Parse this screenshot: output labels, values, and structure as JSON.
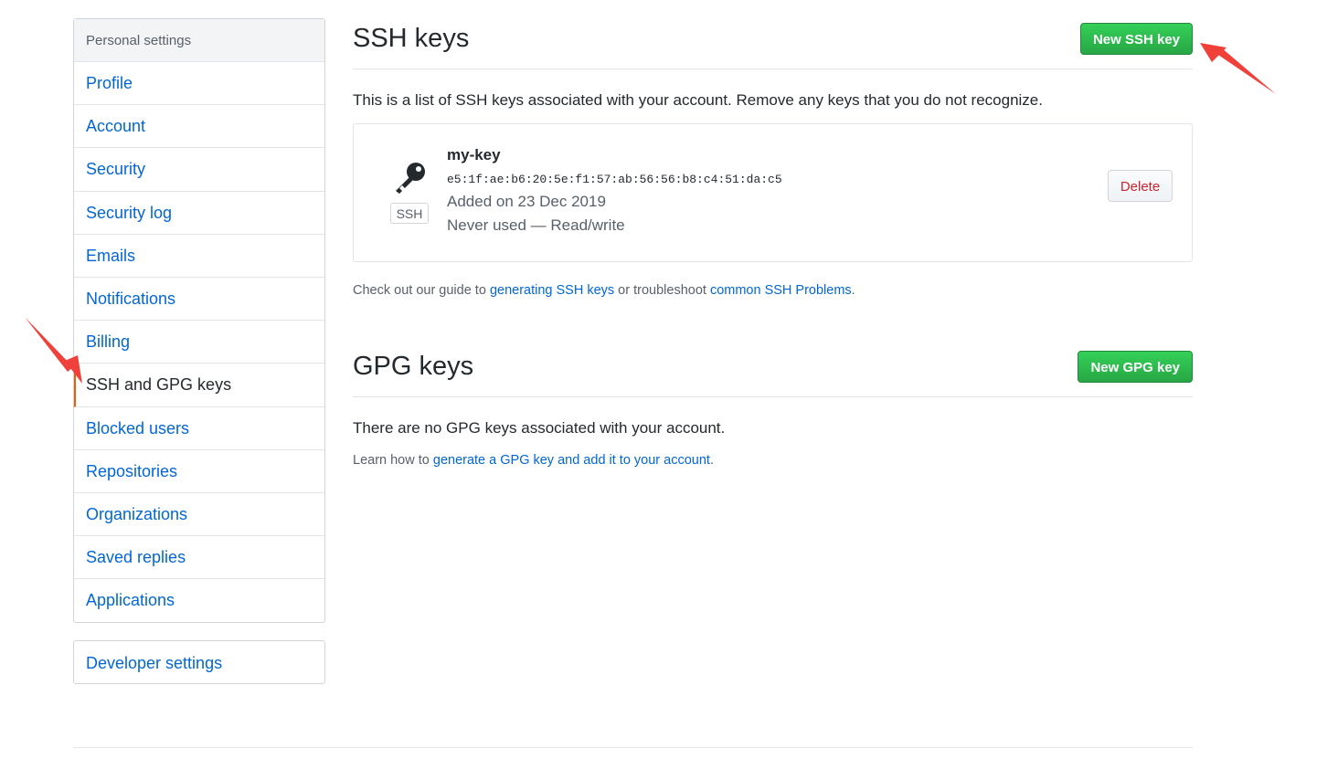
{
  "sidebar": {
    "header": "Personal settings",
    "items": [
      {
        "label": "Profile"
      },
      {
        "label": "Account"
      },
      {
        "label": "Security"
      },
      {
        "label": "Security log"
      },
      {
        "label": "Emails"
      },
      {
        "label": "Notifications"
      },
      {
        "label": "Billing"
      },
      {
        "label": "SSH and GPG keys",
        "selected": true
      },
      {
        "label": "Blocked users"
      },
      {
        "label": "Repositories"
      },
      {
        "label": "Organizations"
      },
      {
        "label": "Saved replies"
      },
      {
        "label": "Applications"
      }
    ],
    "developer_settings": "Developer settings"
  },
  "ssh": {
    "title": "SSH keys",
    "new_button": "New SSH key",
    "description": "This is a list of SSH keys associated with your account. Remove any keys that you do not recognize.",
    "key": {
      "icon": "key-icon",
      "type_tag": "SSH",
      "name": "my-key",
      "fingerprint": "e5:1f:ae:b6:20:5e:f1:57:ab:56:56:b8:c4:51:da:c5",
      "added": "Added on 23 Dec 2019",
      "usage": "Never used — Read/write",
      "delete_label": "Delete"
    },
    "guide": {
      "prefix": "Check out our guide to ",
      "link1": "generating SSH keys",
      "middle": " or troubleshoot ",
      "link2": "common SSH Problems",
      "suffix": "."
    }
  },
  "gpg": {
    "title": "GPG keys",
    "new_button": "New GPG key",
    "empty": "There are no GPG keys associated with your account.",
    "learn": {
      "prefix": "Learn how to ",
      "link": "generate a GPG key and add it to your account",
      "suffix": "."
    }
  },
  "colors": {
    "link": "#0366d6",
    "primary_button": "#28a745",
    "danger": "#cb2431",
    "selected_marker": "#e36209",
    "annotation_arrow": "#f0403a"
  }
}
